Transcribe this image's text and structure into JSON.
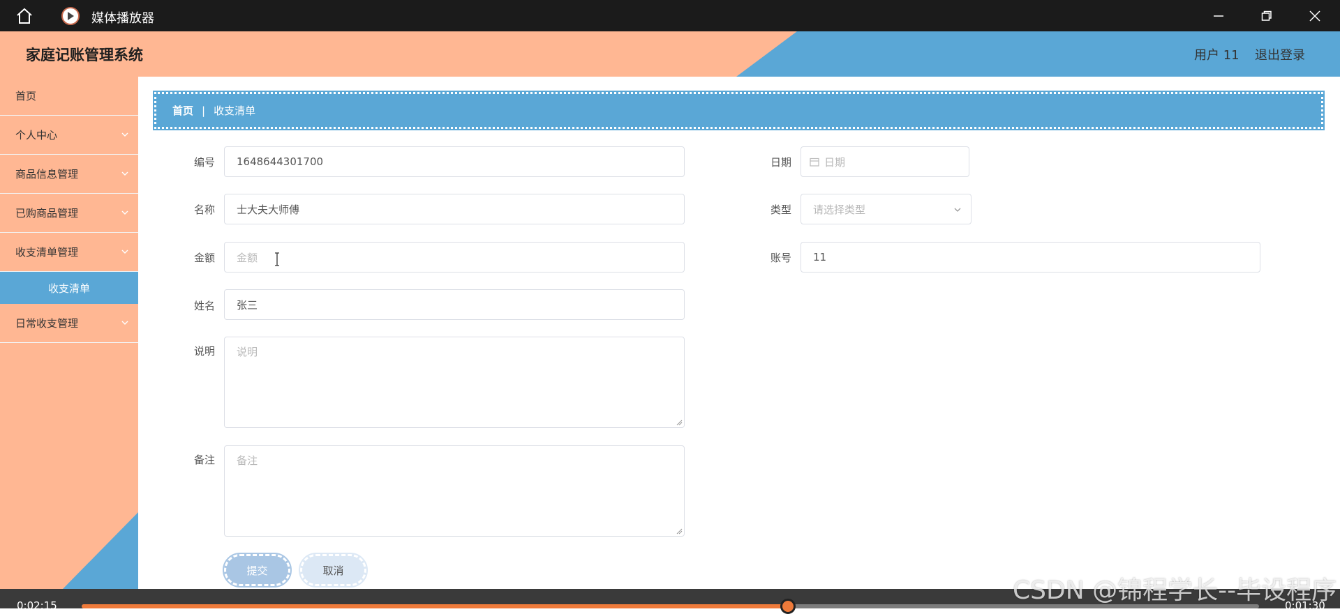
{
  "window": {
    "title": "媒体播放器",
    "icons": [
      "home-icon",
      "play-icon",
      "minimize-icon",
      "restore-icon",
      "close-icon"
    ]
  },
  "header": {
    "title": "家庭记账管理系统",
    "user": "用户 11",
    "logout": "退出登录"
  },
  "sidebar": {
    "items": [
      {
        "label": "首页"
      },
      {
        "label": "个人中心"
      },
      {
        "label": "商品信息管理"
      },
      {
        "label": "已购商品管理"
      },
      {
        "label": "收支清单管理"
      },
      {
        "label": "收支清单"
      },
      {
        "label": "日常收支管理"
      }
    ]
  },
  "breadcrumb": {
    "home": "首页",
    "separator": "|",
    "current": "收支清单"
  },
  "form": {
    "number": {
      "label": "编号",
      "value": "1648644301700"
    },
    "date": {
      "label": "日期",
      "placeholder": "日期"
    },
    "name": {
      "label": "名称",
      "value": "士大夫大师傅"
    },
    "type": {
      "label": "类型",
      "placeholder": "请选择类型"
    },
    "amount": {
      "label": "金额",
      "placeholder": "金额"
    },
    "account": {
      "label": "账号",
      "value": "11"
    },
    "person": {
      "label": "姓名",
      "value": "张三"
    },
    "description": {
      "label": "说明",
      "placeholder": "说明"
    },
    "remark": {
      "label": "备注",
      "placeholder": "备注"
    },
    "submit": "提交",
    "cancel": "取消"
  },
  "player": {
    "elapsed": "0:02:15",
    "remaining": "0:01:30",
    "progress": 0.6
  },
  "watermark": "CSDN @锦程学长--毕设程序",
  "colors": {
    "peach": "#ffb793",
    "blue": "#5aa7d6",
    "accent": "#ee7a3a"
  }
}
